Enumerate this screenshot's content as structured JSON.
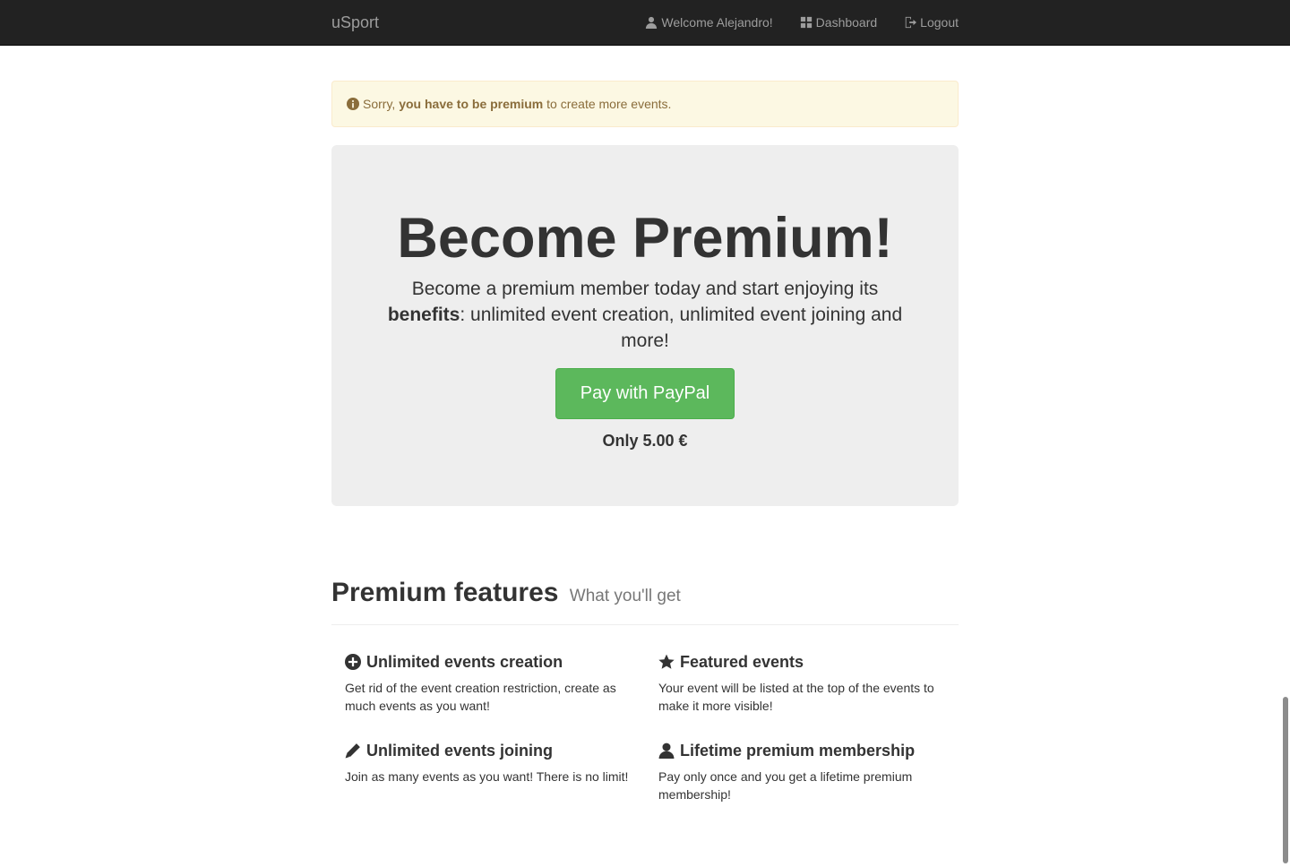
{
  "navbar": {
    "brand": "uSport",
    "welcome": "Welcome Alejandro!",
    "dashboard": "Dashboard",
    "logout": "Logout"
  },
  "alert": {
    "prefix": "Sorry,",
    "bold": "you have to be premium",
    "suffix": "to create more events."
  },
  "jumbotron": {
    "title": "Become Premium!",
    "text_before": "Become a premium member today and start enjoying its",
    "text_bold": "benefits",
    "text_after": ": unlimited event creation, unlimited event joining and more!",
    "button_label": "Pay with PayPal",
    "price": "Only 5.00 €"
  },
  "features": {
    "title": "Premium features",
    "subtitle": "What you'll get",
    "items": [
      {
        "icon": "plus-circle-icon",
        "title": "Unlimited events creation",
        "text": "Get rid of the event creation restriction, create as much events as you want!"
      },
      {
        "icon": "star-icon",
        "title": "Featured events",
        "text": "Your event will be listed at the top of the events to make it more visible!"
      },
      {
        "icon": "pencil-icon",
        "title": "Unlimited events joining",
        "text": "Join as many events as you want! There is no limit!"
      },
      {
        "icon": "user-icon",
        "title": "Lifetime premium membership",
        "text": "Pay only once and you get a lifetime premium membership!"
      }
    ]
  },
  "colors": {
    "navbar": "#222222",
    "alert_bg": "#fcf8e3",
    "alert_text": "#8a6d3b",
    "jumbotron_bg": "#eeeeee",
    "button": "#5cb85c"
  }
}
